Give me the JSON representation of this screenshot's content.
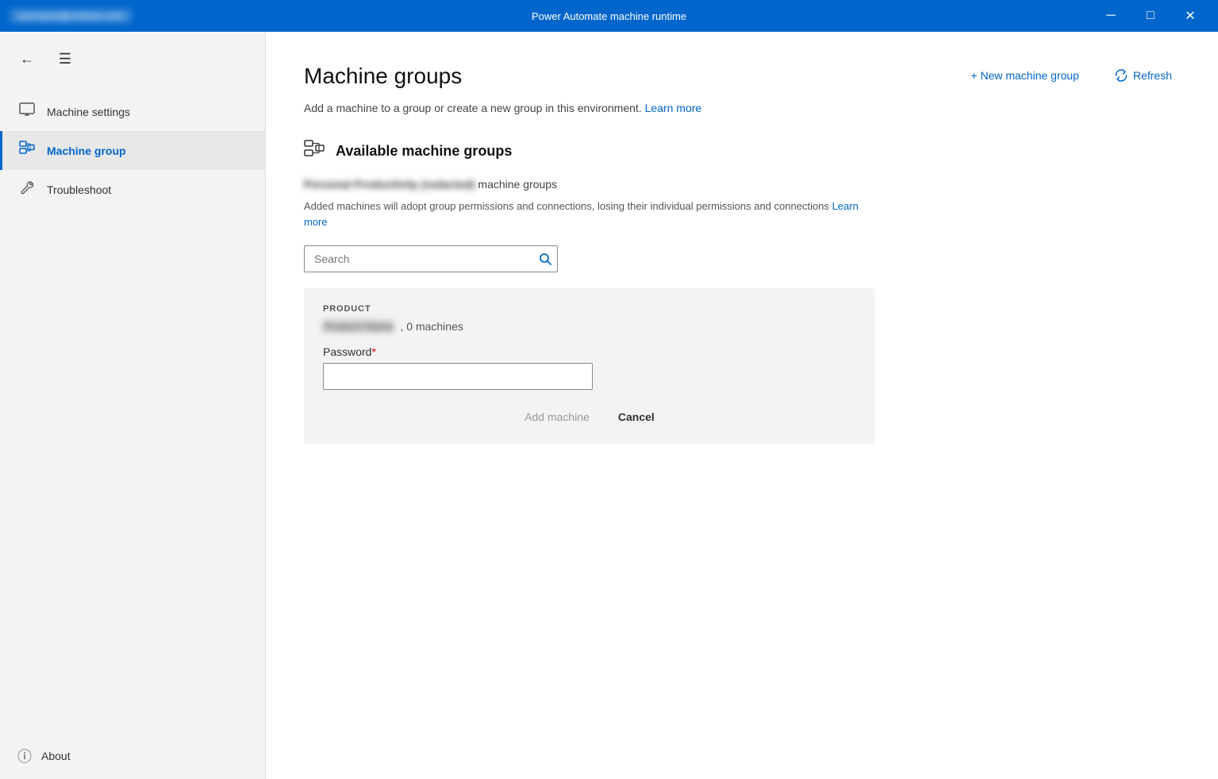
{
  "titleBar": {
    "title": "Power Automate machine runtime",
    "userLabel": "username@contoso.com",
    "minBtn": "─",
    "maxBtn": "□",
    "closeBtn": "✕"
  },
  "sidebar": {
    "backLabel": "←",
    "hamburgerLabel": "☰",
    "navItems": [
      {
        "id": "machine-settings",
        "label": "Machine settings",
        "active": false
      },
      {
        "id": "machine-group",
        "label": "Machine group",
        "active": true
      },
      {
        "id": "troubleshoot",
        "label": "Troubleshoot",
        "active": false
      }
    ],
    "footer": {
      "label": "About"
    }
  },
  "main": {
    "pageTitle": "Machine groups",
    "subtitle": "Add a machine to a group or create a new group in this environment.",
    "subtitleLinkText": "Learn more",
    "subtitleLinkHref": "#",
    "newGroupBtn": "+ New machine group",
    "refreshBtn": "Refresh",
    "sectionTitle": "Available machine groups",
    "envNameBlurred": "Personal Productivity (redacted)",
    "envSuffix": " machine groups",
    "permissionsText": "Added machines will adopt group permissions and connections, losing their individual permissions and connections",
    "permissionsLinkText": "Learn more",
    "permissionsLinkHref": "#",
    "search": {
      "placeholder": "Search"
    },
    "productCard": {
      "columnLabel": "PRODUCT",
      "productNameBlurred": "Product Name",
      "machineCount": ", 0 machines",
      "passwordLabel": "Password",
      "passwordPlaceholder": "",
      "addMachineBtn": "Add machine",
      "cancelBtn": "Cancel"
    }
  }
}
